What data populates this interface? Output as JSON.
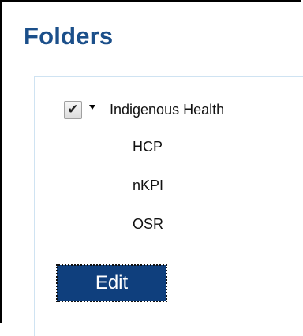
{
  "header": {
    "title": "Folders"
  },
  "tree": {
    "root": {
      "label": "Indigenous Health",
      "checked": true,
      "expanded": true,
      "check_icon": "checkmark-icon",
      "toggle_icon": "caret-down-icon"
    },
    "children": [
      {
        "label": "HCP"
      },
      {
        "label": "nKPI"
      },
      {
        "label": "OSR"
      }
    ]
  },
  "actions": {
    "edit_label": "Edit"
  },
  "colors": {
    "title": "#1b4f8a",
    "button_bg": "#0f3f7d",
    "panel_border": "#cfe3f2"
  }
}
